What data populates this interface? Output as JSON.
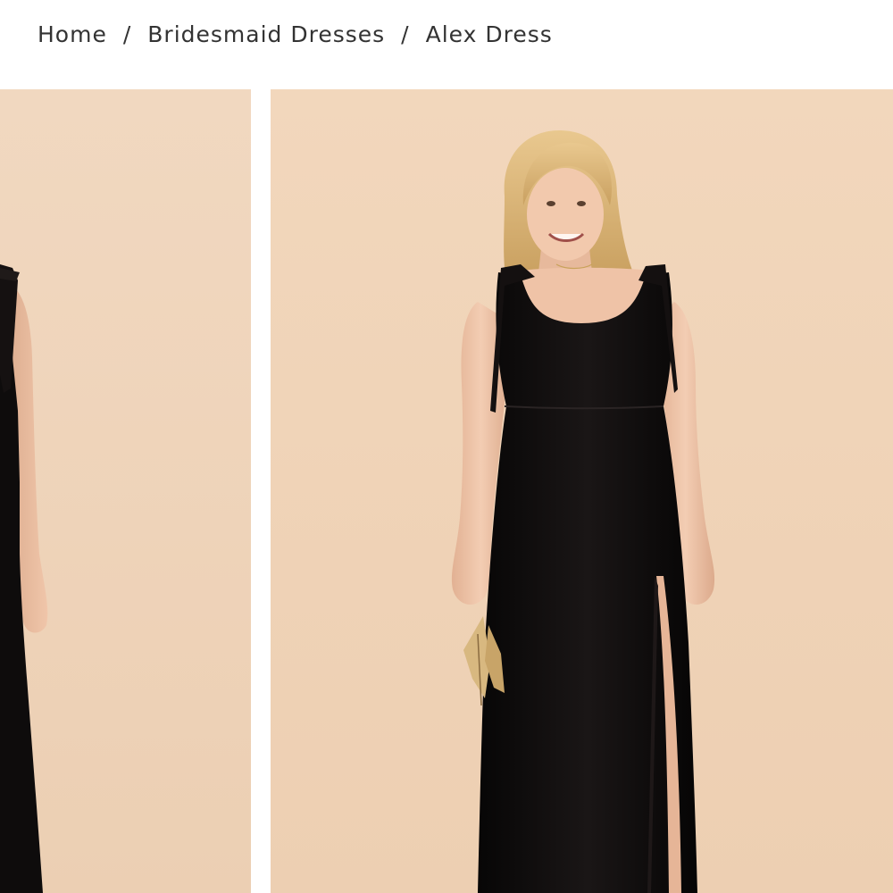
{
  "breadcrumb": {
    "items": [
      {
        "label": "Home"
      },
      {
        "label": "Bridesmaid Dresses"
      }
    ],
    "separator": "/",
    "current": "Alex Dress"
  },
  "gallery": {
    "background_color": "#f0d5bb",
    "dress_color": "#0d0b0b"
  }
}
